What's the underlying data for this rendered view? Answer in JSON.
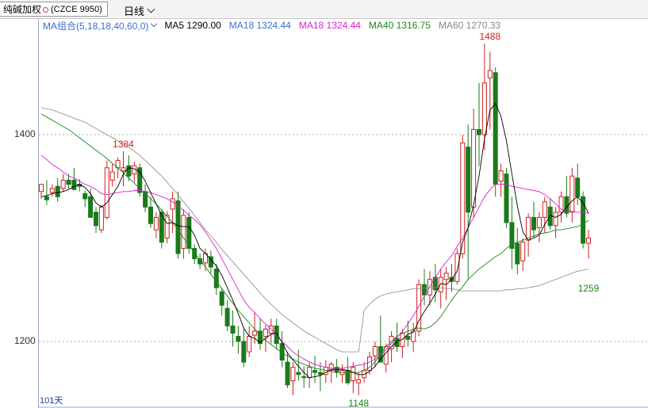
{
  "header": {
    "instrument": "纯碱加权",
    "code": "(CZCE 9950)",
    "period": "日线"
  },
  "legend": {
    "group": "MA组合(5,18,18,40,60,0)",
    "items": [
      {
        "label": "MA5 1290.00",
        "color": "#000000"
      },
      {
        "label": "MA18 1324.44",
        "color": "#3d6fd0"
      },
      {
        "label": "MA18 1324.44",
        "color": "#e020d0"
      },
      {
        "label": "MA40 1316.75",
        "color": "#1a8a1a"
      },
      {
        "label": "MA60 1270.33",
        "color": "#888888"
      }
    ]
  },
  "bottom_label": "101天",
  "chart_data": {
    "type": "candlestick",
    "y_ticks": [
      1200,
      1400
    ],
    "ylim": [
      1140,
      1500
    ],
    "grid": "dashed horizontal at y ticks",
    "annotations": [
      {
        "text": "1384",
        "value": 1384,
        "index": 15,
        "color": "#d02020",
        "pos": "above"
      },
      {
        "text": "1148",
        "value": 1148,
        "index": 58,
        "color": "#1a8a1a",
        "pos": "below"
      },
      {
        "text": "1488",
        "value": 1488,
        "index": 82,
        "color": "#d02020",
        "pos": "above"
      },
      {
        "text": "1259",
        "value": 1259,
        "index": 100,
        "color": "#1a8a1a",
        "pos": "below"
      }
    ],
    "colors": {
      "up": "#d02020",
      "down": "#1a7a1a",
      "ma5": "#000000",
      "ma18": "#e020d0",
      "ma40": "#1a8a1a",
      "ma60": "#888888"
    },
    "candles": [
      [
        1345,
        1352,
        1338,
        1352
      ],
      [
        1340,
        1356,
        1332,
        1337
      ],
      [
        1344,
        1352,
        1340,
        1348
      ],
      [
        1350,
        1358,
        1335,
        1340
      ],
      [
        1348,
        1362,
        1345,
        1356
      ],
      [
        1356,
        1362,
        1348,
        1352
      ],
      [
        1356,
        1368,
        1346,
        1347
      ],
      [
        1352,
        1357,
        1345,
        1350
      ],
      [
        1343,
        1346,
        1330,
        1338
      ],
      [
        1340,
        1348,
        1320,
        1320
      ],
      [
        1325,
        1330,
        1305,
        1312
      ],
      [
        1308,
        1332,
        1305,
        1330
      ],
      [
        1320,
        1375,
        1318,
        1368
      ],
      [
        1356,
        1372,
        1350,
        1364
      ],
      [
        1368,
        1378,
        1358,
        1375
      ],
      [
        1365,
        1384,
        1350,
        1368
      ],
      [
        1370,
        1380,
        1355,
        1360
      ],
      [
        1362,
        1374,
        1354,
        1370
      ],
      [
        1368,
        1372,
        1340,
        1344
      ],
      [
        1345,
        1352,
        1325,
        1330
      ],
      [
        1330,
        1340,
        1310,
        1314
      ],
      [
        1308,
        1325,
        1300,
        1320
      ],
      [
        1325,
        1328,
        1290,
        1296
      ],
      [
        1300,
        1326,
        1295,
        1322
      ],
      [
        1328,
        1345,
        1305,
        1338
      ],
      [
        1336,
        1345,
        1280,
        1285
      ],
      [
        1290,
        1328,
        1280,
        1322
      ],
      [
        1320,
        1325,
        1285,
        1290
      ],
      [
        1290,
        1294,
        1275,
        1280
      ],
      [
        1280,
        1285,
        1270,
        1275
      ],
      [
        1276,
        1290,
        1268,
        1285
      ],
      [
        1282,
        1288,
        1266,
        1272
      ],
      [
        1270,
        1275,
        1245,
        1252
      ],
      [
        1248,
        1252,
        1225,
        1235
      ],
      [
        1232,
        1240,
        1210,
        1215
      ],
      [
        1215,
        1230,
        1195,
        1208
      ],
      [
        1205,
        1215,
        1188,
        1200
      ],
      [
        1200,
        1212,
        1175,
        1180
      ],
      [
        1190,
        1215,
        1185,
        1205
      ],
      [
        1206,
        1228,
        1198,
        1210
      ],
      [
        1210,
        1222,
        1192,
        1198
      ],
      [
        1205,
        1216,
        1190,
        1212
      ],
      [
        1208,
        1222,
        1198,
        1215
      ],
      [
        1215,
        1222,
        1192,
        1198
      ],
      [
        1198,
        1210,
        1175,
        1182
      ],
      [
        1180,
        1190,
        1155,
        1158
      ],
      [
        1162,
        1180,
        1148,
        1175
      ],
      [
        1170,
        1192,
        1162,
        1168
      ],
      [
        1166,
        1176,
        1155,
        1165
      ],
      [
        1165,
        1180,
        1155,
        1175
      ],
      [
        1172,
        1186,
        1160,
        1170
      ],
      [
        1170,
        1180,
        1152,
        1168
      ],
      [
        1168,
        1182,
        1160,
        1175
      ],
      [
        1172,
        1180,
        1160,
        1178
      ],
      [
        1175,
        1183,
        1165,
        1170
      ],
      [
        1168,
        1178,
        1160,
        1172
      ],
      [
        1172,
        1185,
        1158,
        1160
      ],
      [
        1162,
        1180,
        1150,
        1175
      ],
      [
        1160,
        1170,
        1148,
        1163
      ],
      [
        1165,
        1180,
        1160,
        1172
      ],
      [
        1172,
        1190,
        1168,
        1185
      ],
      [
        1186,
        1200,
        1175,
        1195
      ],
      [
        1195,
        1225,
        1188,
        1180
      ],
      [
        1178,
        1198,
        1170,
        1195
      ],
      [
        1193,
        1210,
        1180,
        1205
      ],
      [
        1203,
        1218,
        1190,
        1195
      ],
      [
        1195,
        1212,
        1184,
        1208
      ],
      [
        1205,
        1220,
        1195,
        1202
      ],
      [
        1200,
        1218,
        1190,
        1210
      ],
      [
        1210,
        1260,
        1205,
        1255
      ],
      [
        1255,
        1270,
        1235,
        1245
      ],
      [
        1245,
        1268,
        1235,
        1260
      ],
      [
        1262,
        1275,
        1238,
        1250
      ],
      [
        1248,
        1270,
        1232,
        1262
      ],
      [
        1260,
        1272,
        1240,
        1266
      ],
      [
        1262,
        1275,
        1248,
        1258
      ],
      [
        1258,
        1290,
        1255,
        1285
      ],
      [
        1285,
        1400,
        1280,
        1392
      ],
      [
        1388,
        1410,
        1260,
        1325
      ],
      [
        1330,
        1425,
        1320,
        1405
      ],
      [
        1405,
        1450,
        1370,
        1400
      ],
      [
        1400,
        1488,
        1385,
        1450
      ],
      [
        1455,
        1480,
        1405,
        1462
      ],
      [
        1460,
        1465,
        1340,
        1352
      ],
      [
        1355,
        1372,
        1340,
        1365
      ],
      [
        1362,
        1368,
        1310,
        1315
      ],
      [
        1315,
        1340,
        1270,
        1290
      ],
      [
        1295,
        1310,
        1265,
        1275
      ],
      [
        1278,
        1300,
        1268,
        1296
      ],
      [
        1298,
        1324,
        1282,
        1320
      ],
      [
        1320,
        1335,
        1300,
        1308
      ],
      [
        1310,
        1325,
        1296,
        1320
      ],
      [
        1320,
        1340,
        1305,
        1335
      ],
      [
        1330,
        1338,
        1308,
        1312
      ],
      [
        1312,
        1330,
        1300,
        1325
      ],
      [
        1325,
        1345,
        1315,
        1340
      ],
      [
        1340,
        1360,
        1320,
        1324
      ],
      [
        1325,
        1368,
        1315,
        1360
      ],
      [
        1358,
        1372,
        1332,
        1340
      ],
      [
        1340,
        1345,
        1290,
        1295
      ],
      [
        1295,
        1308,
        1280,
        1300
      ]
    ],
    "ma5": [
      1340,
      1341,
      1343,
      1344,
      1345,
      1347,
      1350,
      1352,
      1349,
      1343,
      1334,
      1330,
      1334,
      1342,
      1350,
      1362,
      1368,
      1367,
      1364,
      1355,
      1344,
      1333,
      1322,
      1314,
      1315,
      1312,
      1311,
      1311,
      1303,
      1290,
      1285,
      1279,
      1273,
      1264,
      1252,
      1240,
      1227,
      1213,
      1205,
      1203,
      1199,
      1203,
      1207,
      1208,
      1199,
      1189,
      1182,
      1176,
      1170,
      1165,
      1166,
      1167,
      1170,
      1173,
      1173,
      1173,
      1172,
      1170,
      1168,
      1168,
      1171,
      1176,
      1183,
      1189,
      1195,
      1200,
      1202,
      1207,
      1209,
      1220,
      1229,
      1237,
      1246,
      1256,
      1255,
      1260,
      1268,
      1296,
      1310,
      1332,
      1360,
      1396,
      1424,
      1430,
      1418,
      1394,
      1362,
      1331,
      1306,
      1298,
      1300,
      1303,
      1313,
      1322,
      1320,
      1323,
      1330,
      1336,
      1340,
      1334,
      1324
    ],
    "ma18": [
      1380,
      1376,
      1371,
      1368,
      1364,
      1360,
      1358,
      1355,
      1352,
      1350,
      1347,
      1343,
      1342,
      1343,
      1344,
      1345,
      1345,
      1346,
      1346,
      1345,
      1344,
      1342,
      1340,
      1338,
      1335,
      1331,
      1327,
      1322,
      1318,
      1313,
      1306,
      1298,
      1290,
      1280,
      1270,
      1260,
      1250,
      1240,
      1233,
      1228,
      1222,
      1217,
      1212,
      1206,
      1200,
      1195,
      1190,
      1186,
      1183,
      1180,
      1178,
      1176,
      1175,
      1174,
      1174,
      1174,
      1175,
      1176,
      1177,
      1178,
      1180,
      1183,
      1187,
      1192,
      1198,
      1204,
      1210,
      1217,
      1225,
      1234,
      1244,
      1253,
      1262,
      1270,
      1277,
      1283,
      1292,
      1300,
      1310,
      1320,
      1330,
      1340,
      1347,
      1352,
      1352,
      1352,
      1350,
      1349,
      1348,
      1347,
      1346,
      1345,
      1342,
      1338,
      1333,
      1328,
      1326,
      1326,
      1325,
      1325,
      1324
    ],
    "ma40": [
      1420,
      1417,
      1414,
      1411,
      1408,
      1405,
      1401,
      1397,
      1393,
      1389,
      1385,
      1381,
      1377,
      1372,
      1368,
      1363,
      1358,
      1353,
      1348,
      1343,
      1338,
      1333,
      1327,
      1321,
      1315,
      1308,
      1300,
      1293,
      1286,
      1279,
      1272,
      1265,
      1258,
      1251,
      1244,
      1237,
      1230,
      1224,
      1218,
      1212,
      1206,
      1201,
      1197,
      1193,
      1189,
      1186,
      1183,
      1180,
      1178,
      1176,
      1174,
      1173,
      1172,
      1171,
      1170,
      1170,
      1170,
      1170,
      1170,
      1172,
      1175,
      1180,
      1188,
      1195,
      1200,
      1205,
      1208,
      1210,
      1212,
      1213,
      1212,
      1214,
      1218,
      1224,
      1232,
      1240,
      1247,
      1253,
      1260,
      1265,
      1270,
      1274,
      1278,
      1282,
      1285,
      1290,
      1294,
      1296,
      1298,
      1300,
      1302,
      1304,
      1305,
      1306,
      1308,
      1308,
      1309,
      1310,
      1311,
      1314,
      1317
    ],
    "ma60": [
      1426,
      1425,
      1424,
      1422,
      1420,
      1418,
      1416,
      1414,
      1412,
      1409,
      1406,
      1403,
      1400,
      1397,
      1394,
      1391,
      1388,
      1384,
      1380,
      1375,
      1370,
      1365,
      1360,
      1354,
      1348,
      1342,
      1335,
      1329,
      1322,
      1315,
      1308,
      1302,
      1296,
      1289,
      1283,
      1277,
      1271,
      1265,
      1259,
      1253,
      1247,
      1241,
      1236,
      1231,
      1226,
      1222,
      1218,
      1214,
      1210,
      1207,
      1204,
      1201,
      1198,
      1195,
      1192,
      1190,
      1190,
      1190,
      1190,
      1230,
      1236,
      1241,
      1244,
      1246,
      1247,
      1248,
      1249,
      1250,
      1251,
      1251,
      1252,
      1252,
      1252,
      1252,
      1251,
      1251,
      1250,
      1249,
      1249,
      1249,
      1249,
      1249,
      1249,
      1249,
      1249,
      1250,
      1250,
      1251,
      1251,
      1252,
      1253,
      1254,
      1256,
      1258,
      1260,
      1262,
      1264,
      1266,
      1268,
      1269,
      1270
    ]
  }
}
